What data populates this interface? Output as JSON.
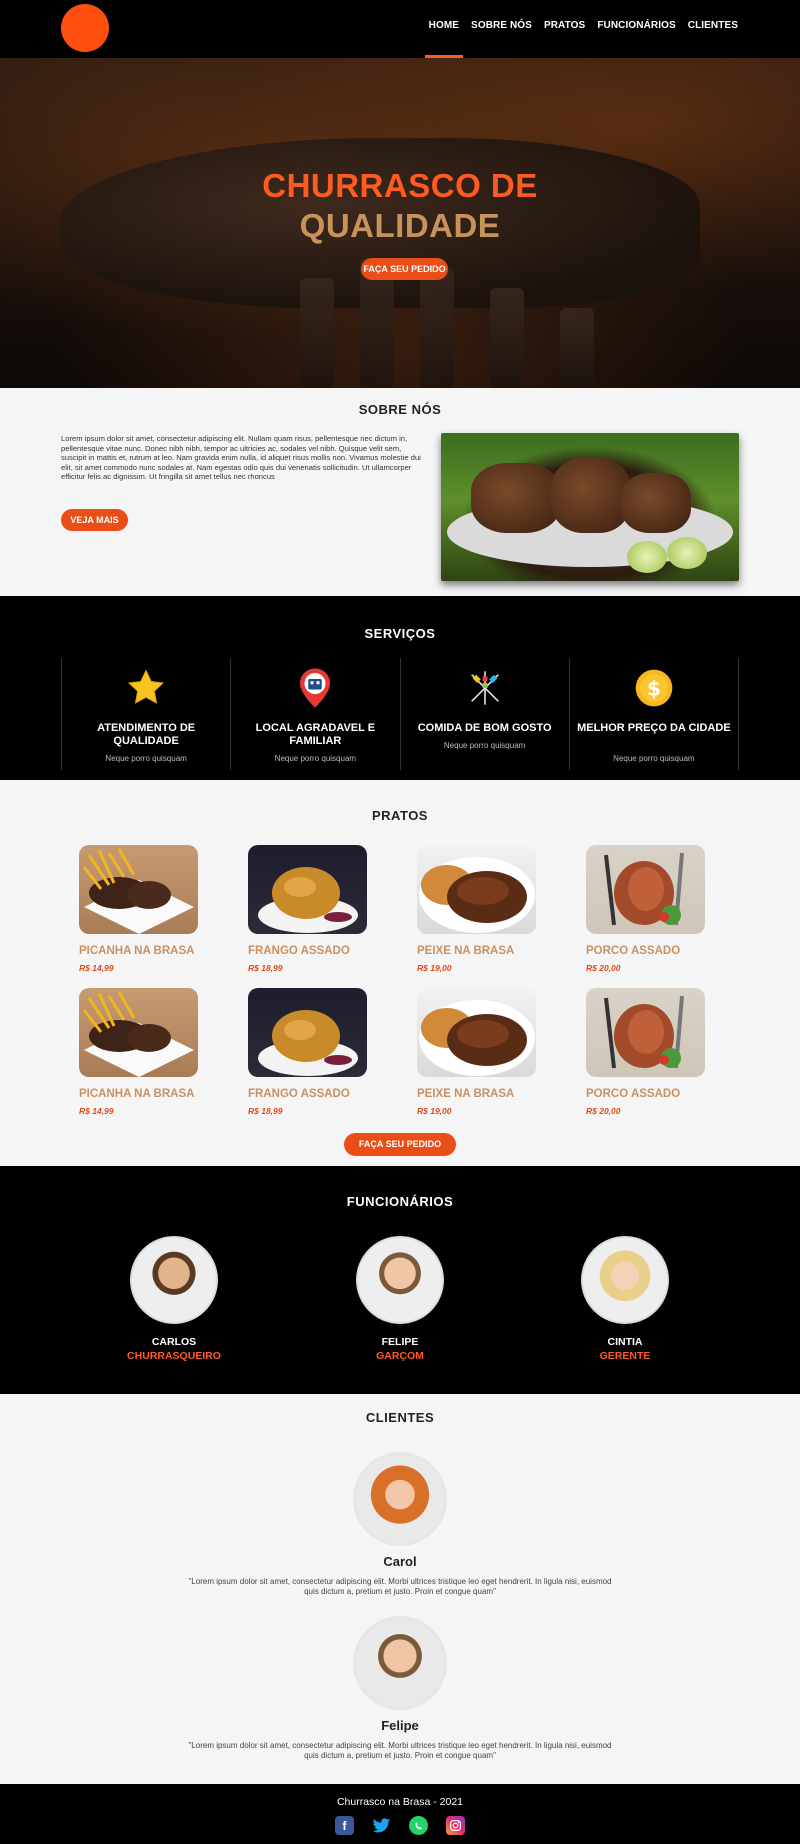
{
  "nav": {
    "items": [
      {
        "label": "HOME",
        "active": true
      },
      {
        "label": "SOBRE NÓS"
      },
      {
        "label": "PRATOS"
      },
      {
        "label": "FUNCIONÁRIOS"
      },
      {
        "label": "CLIENTES"
      }
    ]
  },
  "hero": {
    "title_line1": "CHURRASCO DE",
    "title_line2": "QUALIDADE",
    "cta": "FAÇA SEU PEDIDO"
  },
  "about": {
    "title": "SOBRE NÓS",
    "text": "Lorem ipsum dolor sit amet, consectetur adipiscing elit. Nullam quam risus, pellentesque nec dictum in, pellentesque vitae nunc. Donec nibh nibh, tempor ac ultricies ac, sodales vel nibh. Quisque velit sem, suscipit in mattis et, rutrum at leo. Nam gravida enim nulla, id aliquet risus mollis non. Vivamus molestie dui elit, sit amet commodo nunc sodales at. Nam egestas odio quis dui venenatis sollicitudin. Ut ullamcorper efficitur felis ac dignissim. Ut fringilla sit amet tellus nec rhoncus",
    "button": "VEJA MAIS"
  },
  "services": {
    "title": "SERVIÇOS",
    "items": [
      {
        "title": "ATENDIMENTO DE QUALIDADE",
        "sub": "Neque porro quisquam",
        "icon": "star-icon"
      },
      {
        "title": "LOCAL AGRADAVEL E FAMILIAR",
        "sub": "Neque porro quisquam",
        "icon": "location-pin-icon"
      },
      {
        "title": "COMIDA DE BOM GOSTO",
        "sub": "Neque porro quisquam",
        "icon": "skewers-icon"
      },
      {
        "title": "MELHOR PREÇO DA CIDADE",
        "sub": "Neque porro quisquam",
        "icon": "dollar-coin-icon"
      }
    ]
  },
  "dishes": {
    "title": "PRATOS",
    "items": [
      {
        "name": "PICANHA NA BRASA",
        "price": "R$ 14,99"
      },
      {
        "name": "FRANGO ASSADO",
        "price": "R$ 18,99"
      },
      {
        "name": "PEIXE NA BRASA",
        "price": "R$ 19,00"
      },
      {
        "name": "PORCO ASSADO",
        "price": "R$ 20,00"
      },
      {
        "name": "PICANHA NA BRASA",
        "price": "R$ 14,99"
      },
      {
        "name": "FRANGO ASSADO",
        "price": "R$ 18,99"
      },
      {
        "name": "PEIXE NA BRASA",
        "price": "R$ 19,00"
      },
      {
        "name": "PORCO ASSADO",
        "price": "R$ 20,00"
      }
    ],
    "button": "FAÇA SEU PEDIDO"
  },
  "staff": {
    "title": "FUNCIONÁRIOS",
    "people": [
      {
        "name": "CARLOS",
        "role": "CHURRASQUEIRO"
      },
      {
        "name": "FELIPE",
        "role": "GARÇOM"
      },
      {
        "name": "CINTIA",
        "role": "GERENTE"
      }
    ]
  },
  "clients": {
    "title": "CLIENTES",
    "items": [
      {
        "name": "Carol",
        "quote": "\"Lorem ipsum dolor sit amet, consectetur adipiscing elit. Morbi ultrices tristique leo eget hendrerit. In ligula nisi, euismod quis dictum a, pretium et justo. Proin et congue quam\""
      },
      {
        "name": "Felipe",
        "quote": "\"Lorem ipsum dolor sit amet, consectetur adipiscing elit. Morbi ultrices tristique leo eget hendrerit. In ligula nisi, euismod quis dictum a, pretium et justo. Proin et congue quam\""
      }
    ]
  },
  "footer": {
    "text": "Churrasco na Brasa - 2021",
    "socials": [
      "facebook-icon",
      "twitter-icon",
      "whatsapp-icon",
      "instagram-icon"
    ]
  },
  "colors": {
    "accent": "#ff5a1f",
    "gold": "#c8935b",
    "button": "#ea4e18",
    "dark": "#000000"
  }
}
